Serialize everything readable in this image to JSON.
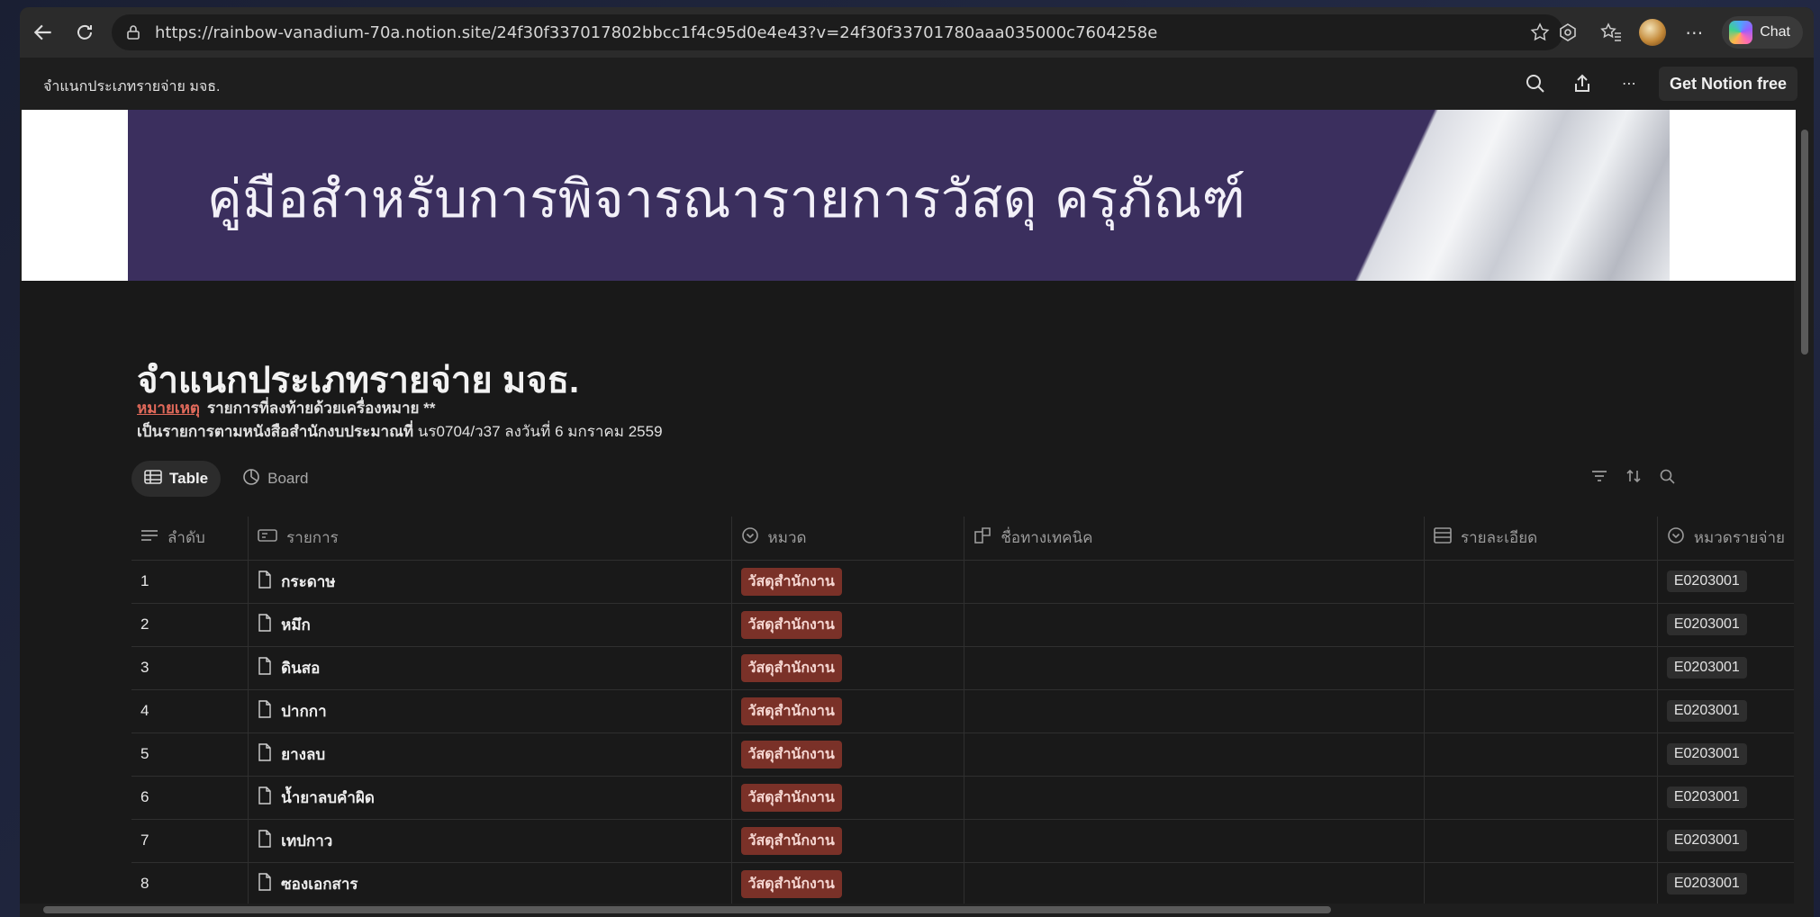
{
  "browser": {
    "url": "https://rainbow-vanadium-70a.notion.site/24f30f337017802bbcc1f4c95d0e4e43?v=24f30f33701780aaa035000c7604258e",
    "chat_label": "Chat",
    "icons": [
      "back-icon",
      "refresh-icon",
      "lock-icon",
      "star-icon",
      "extensions-icon",
      "favorites-icon",
      "profile-avatar",
      "more-icon",
      "copilot-icon"
    ]
  },
  "notion_bar": {
    "page_title": "จำแนกประเภทรายจ่าย มจธ.",
    "get_notion_label": "Get Notion free"
  },
  "cover": {
    "title": "คู่มือสำหรับการพิจารณารายการวัสดุ ครุภัณฑ์",
    "colors": {
      "band": "#3b2f5e"
    }
  },
  "page": {
    "title": "จำแนกประเภทรายจ่าย มจธ.",
    "note_label": "หมายเหตุ",
    "note_text": "รายการที่ลงท้ายด้วยเครื่องหมาย **",
    "note2_bold": "เป็นรายการตามหนังสือสำนักงบประมาณที่",
    "note2_text": "นร0704/ว37 ลงวันที่ 6 มกราคม 2559"
  },
  "views": {
    "tabs": [
      {
        "label": "Table",
        "icon": "table-icon",
        "active": true
      },
      {
        "label": "Board",
        "icon": "board-icon",
        "active": false
      }
    ]
  },
  "table": {
    "columns": [
      {
        "label": "ลำดับ",
        "icon": "text-lines-icon"
      },
      {
        "label": "รายการ",
        "icon": "title-card-icon"
      },
      {
        "label": "หมวด",
        "icon": "select-icon"
      },
      {
        "label": "ชื่อทางเทคนิค",
        "icon": "relation-icon"
      },
      {
        "label": "รายละเอียด",
        "icon": "list-icon"
      },
      {
        "label": "หมวดรายจ่าย",
        "icon": "select-icon"
      }
    ],
    "rows": [
      {
        "no": "1",
        "name": "กระดาษ",
        "category": "วัสดุสำนักงาน",
        "tech": "",
        "detail": "",
        "code": "E0203001"
      },
      {
        "no": "2",
        "name": "หมึก",
        "category": "วัสดุสำนักงาน",
        "tech": "",
        "detail": "",
        "code": "E0203001"
      },
      {
        "no": "3",
        "name": "ดินสอ",
        "category": "วัสดุสำนักงาน",
        "tech": "",
        "detail": "",
        "code": "E0203001"
      },
      {
        "no": "4",
        "name": "ปากกา",
        "category": "วัสดุสำนักงาน",
        "tech": "",
        "detail": "",
        "code": "E0203001"
      },
      {
        "no": "5",
        "name": "ยางลบ",
        "category": "วัสดุสำนักงาน",
        "tech": "",
        "detail": "",
        "code": "E0203001"
      },
      {
        "no": "6",
        "name": "น้ำยาลบคำผิด",
        "category": "วัสดุสำนักงาน",
        "tech": "",
        "detail": "",
        "code": "E0203001"
      },
      {
        "no": "7",
        "name": "เทปกาว",
        "category": "วัสดุสำนักงาน",
        "tech": "",
        "detail": "",
        "code": "E0203001"
      },
      {
        "no": "8",
        "name": "ซองเอกสาร",
        "category": "วัสดุสำนักงาน",
        "tech": "",
        "detail": "",
        "code": "E0203001"
      }
    ],
    "colors": {
      "category_tag": "#7a3128"
    }
  }
}
